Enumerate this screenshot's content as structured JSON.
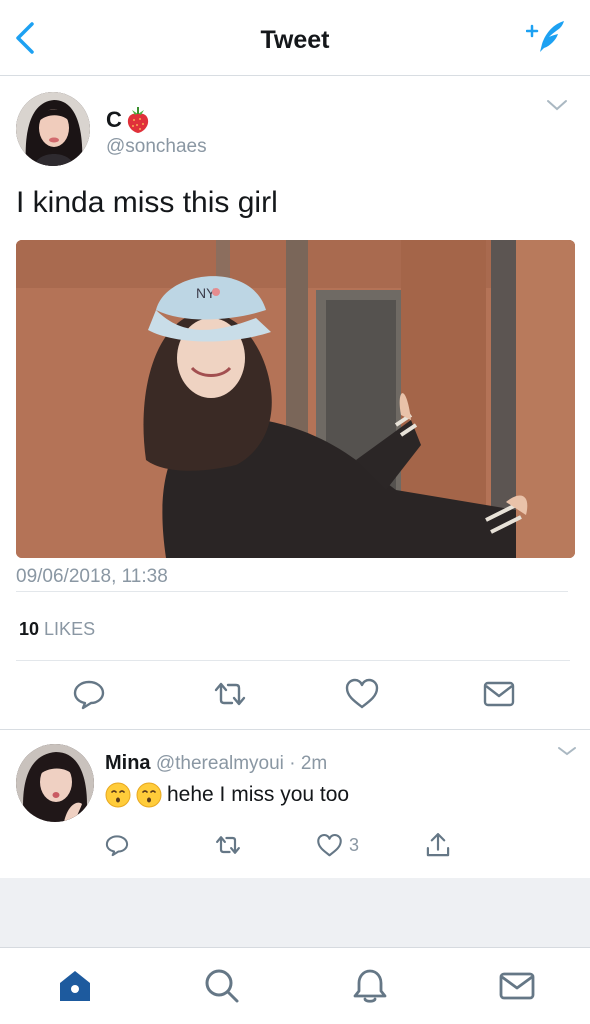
{
  "header": {
    "title": "Tweet",
    "back_icon": "chevron-left-icon",
    "compose_icon": "compose-tweet-icon"
  },
  "tweet": {
    "author_name": "C",
    "name_emoji": "strawberry",
    "handle": "@sonchaes",
    "text": "I kinda miss this girl",
    "timestamp": "09/06/2018, 11:38",
    "likes_count": "10",
    "likes_label": "LIKES",
    "actions": [
      "reply-icon",
      "retweet-icon",
      "like-icon",
      "direct-message-icon"
    ]
  },
  "reply": {
    "author_name": "Mina",
    "handle": "@therealmyoui",
    "separator": "·",
    "time": "2m",
    "text": "hehe I miss you too",
    "emojis": [
      "kissing-face",
      "kissing-face"
    ],
    "like_count": "3",
    "actions": [
      "reply-icon",
      "retweet-icon",
      "like-icon",
      "share-icon"
    ]
  },
  "tabbar": {
    "items": [
      "home-icon",
      "search-icon",
      "notifications-icon",
      "messages-icon"
    ],
    "active": "home-icon"
  },
  "colors": {
    "accent": "#1da1f2",
    "text": "#14171a",
    "secondary": "#8a97a3",
    "border": "#e3e7eb",
    "home_active": "#1d5a9e"
  }
}
